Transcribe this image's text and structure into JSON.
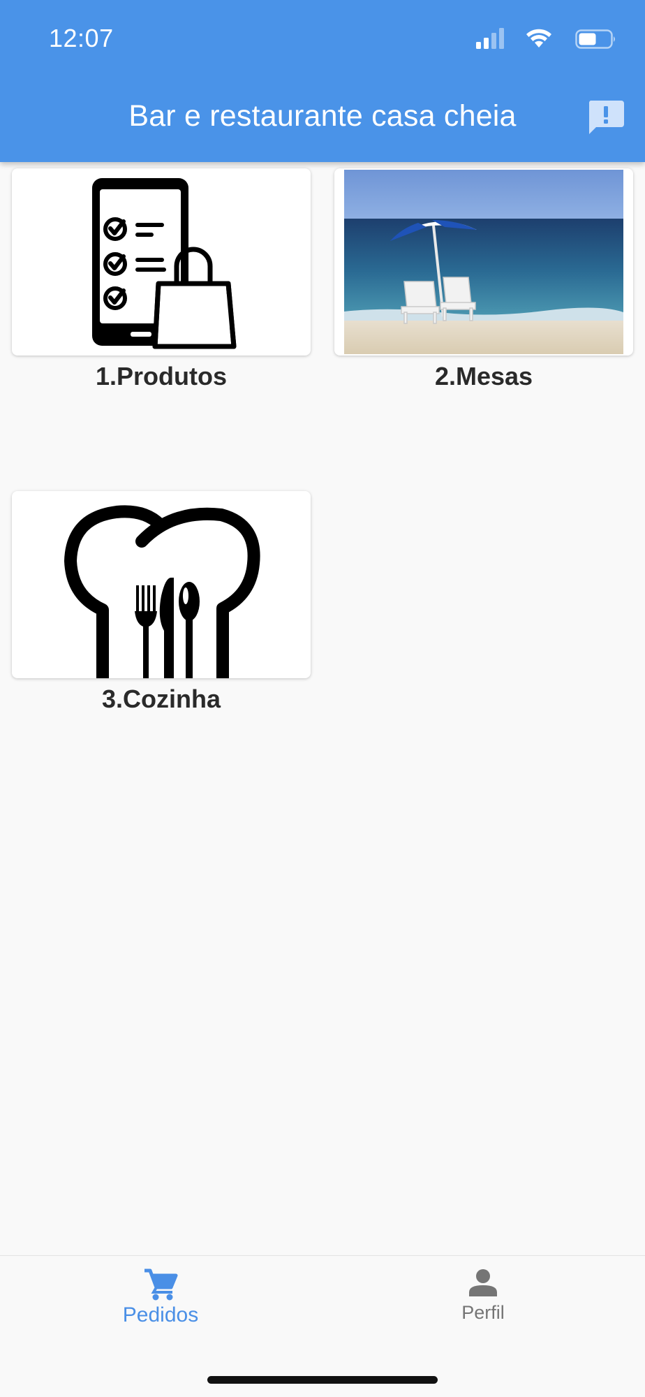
{
  "status_bar": {
    "time": "12:07"
  },
  "header": {
    "title": "Bar e restaurante casa cheia",
    "action_icon": "feedback-icon",
    "background": "#4a93e8"
  },
  "menu": {
    "items": [
      {
        "label": "1.Produtos",
        "icon": "checklist-shopping-bag-icon"
      },
      {
        "label": "2.Mesas",
        "icon": "beach-umbrella-photo"
      },
      {
        "label": "3.Cozinha",
        "icon": "chef-hat-cutlery-icon"
      }
    ]
  },
  "bottom_nav": {
    "items": [
      {
        "label": "Pedidos",
        "icon": "cart-icon",
        "active": true,
        "color": "#4a8fe6"
      },
      {
        "label": "Perfil",
        "icon": "person-icon",
        "active": false,
        "color": "#757575"
      }
    ]
  }
}
